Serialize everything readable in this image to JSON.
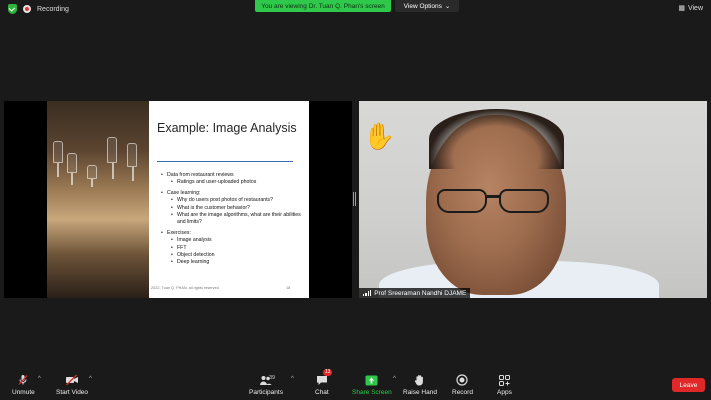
{
  "topbar": {
    "recording_label": "Recording",
    "viewing_label": "You are viewing Dr. Tuan Q. Phan's screen",
    "view_options_label": "View Options",
    "view_label": "View"
  },
  "slide": {
    "title": "Example: Image Analysis",
    "bullets": [
      {
        "text": "Data from restaurant reviews",
        "level": 1
      },
      {
        "text": "Ratings and user-uploaded photos",
        "level": 2
      },
      {
        "text": "Case learning:",
        "level": 1
      },
      {
        "text": "Why do users post photos of restaurants?",
        "level": 2
      },
      {
        "text": "What is the customer behavior?",
        "level": 2
      },
      {
        "text": "What are the image algorithms, what are their abilities and limits?",
        "level": 2
      },
      {
        "text": "Exercises:",
        "level": 1
      },
      {
        "text": "Image analysis",
        "level": 2
      },
      {
        "text": "FFT",
        "level": 2
      },
      {
        "text": "Object detection",
        "level": 2
      },
      {
        "text": "Deep learning",
        "level": 2
      }
    ],
    "footer": "2022, Tuan Q. PHAN, all rights reserved",
    "page_number": "18"
  },
  "participant": {
    "name": "Prof Sreeraman Nandhi DJAME"
  },
  "toolbar": {
    "unmute_label": "Unmute",
    "start_video_label": "Start Video",
    "participants_label": "Participants",
    "participants_count": "39",
    "chat_label": "Chat",
    "chat_badge": "13",
    "share_screen_label": "Share Screen",
    "raise_hand_label": "Raise Hand",
    "record_label": "Record",
    "apps_label": "Apps",
    "leave_label": "Leave"
  },
  "colors": {
    "share_green": "#2ec94a",
    "leave_red": "#e02828",
    "background": "#1a1a1a"
  }
}
